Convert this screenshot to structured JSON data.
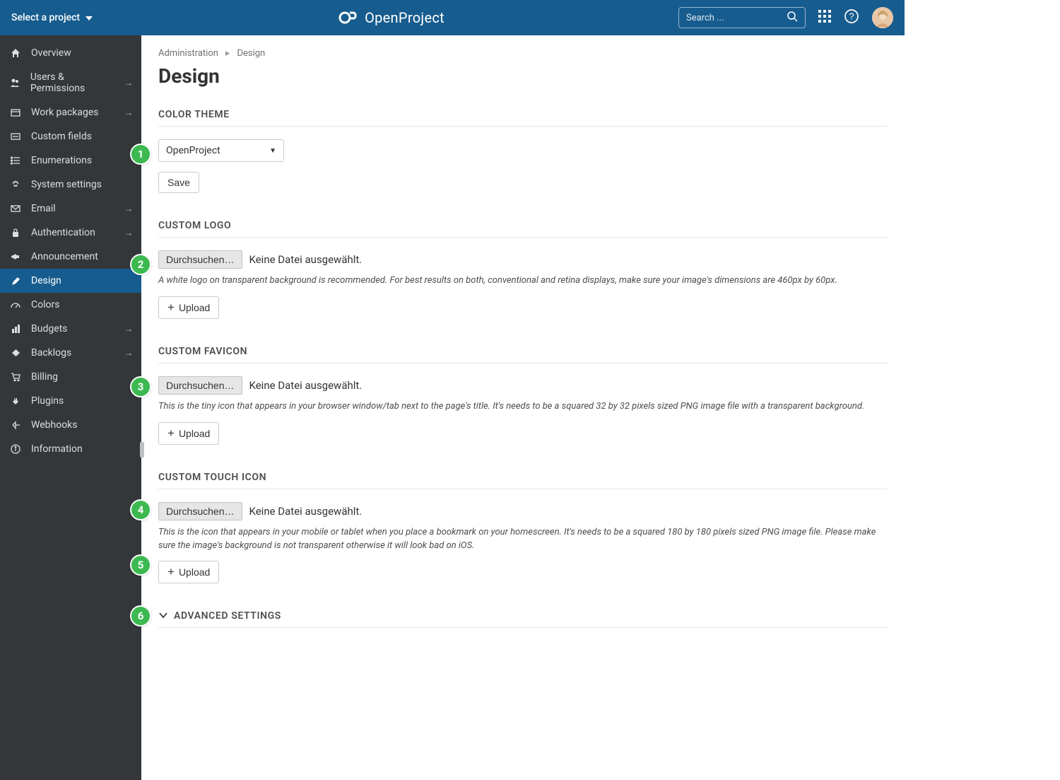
{
  "topbar": {
    "project_selector": "Select a project",
    "logo_text": "OpenProject",
    "search_placeholder": "Search ..."
  },
  "sidebar": {
    "items": [
      {
        "label": "Overview",
        "icon": "home",
        "arrow": false
      },
      {
        "label": "Users & Permissions",
        "icon": "users",
        "arrow": true
      },
      {
        "label": "Work packages",
        "icon": "packages",
        "arrow": true
      },
      {
        "label": "Custom fields",
        "icon": "fields",
        "arrow": false
      },
      {
        "label": "Enumerations",
        "icon": "list",
        "arrow": false
      },
      {
        "label": "System settings",
        "icon": "gear",
        "arrow": false
      },
      {
        "label": "Email",
        "icon": "mail",
        "arrow": true
      },
      {
        "label": "Authentication",
        "icon": "lock",
        "arrow": true
      },
      {
        "label": "Announcement",
        "icon": "bullhorn",
        "arrow": false
      },
      {
        "label": "Design",
        "icon": "pencil",
        "arrow": false,
        "active": true
      },
      {
        "label": "Colors",
        "icon": "gauge",
        "arrow": false
      },
      {
        "label": "Budgets",
        "icon": "budget",
        "arrow": true
      },
      {
        "label": "Backlogs",
        "icon": "backlog",
        "arrow": true
      },
      {
        "label": "Billing",
        "icon": "cart",
        "arrow": false
      },
      {
        "label": "Plugins",
        "icon": "plug",
        "arrow": false
      },
      {
        "label": "Webhooks",
        "icon": "hooks",
        "arrow": false
      },
      {
        "label": "Information",
        "icon": "info",
        "arrow": false
      }
    ]
  },
  "breadcrumb": {
    "root": "Administration",
    "current": "Design"
  },
  "page": {
    "title": "Design"
  },
  "color_theme": {
    "header": "COLOR THEME",
    "selected": "OpenProject",
    "save": "Save"
  },
  "custom_logo": {
    "header": "CUSTOM LOGO",
    "browse": "Durchsuchen…",
    "status": "Keine Datei ausgewählt.",
    "helper": "A white logo on transparent background is recommended. For best results on both, conventional and retina displays, make sure your image's dimensions are 460px by 60px.",
    "upload": "Upload"
  },
  "custom_favicon": {
    "header": "CUSTOM FAVICON",
    "browse": "Durchsuchen…",
    "status": "Keine Datei ausgewählt.",
    "helper": "This is the tiny icon that appears in your browser window/tab next to the page's title. It's needs to be a squared 32 by 32 pixels sized PNG image file with a transparent background.",
    "upload": "Upload"
  },
  "custom_touch": {
    "header": "CUSTOM TOUCH ICON",
    "browse": "Durchsuchen…",
    "status": "Keine Datei ausgewählt.",
    "helper": "This is the icon that appears in your mobile or tablet when you place a bookmark on your homescreen. It's needs to be a squared 180 by 180 pixels sized PNG image file. Please make sure the image's background is not transparent otherwise it will look bad on iOS.",
    "upload": "Upload"
  },
  "advanced": {
    "header": "ADVANCED SETTINGS"
  },
  "markers": [
    "1",
    "2",
    "3",
    "4",
    "5",
    "6"
  ]
}
